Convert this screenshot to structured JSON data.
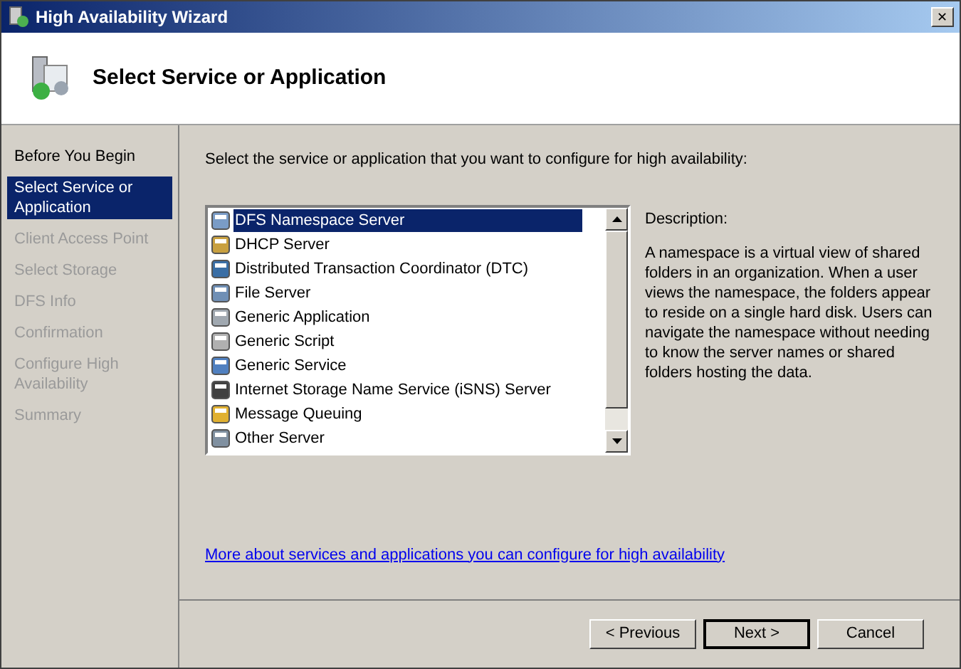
{
  "window": {
    "title": "High Availability Wizard",
    "close": "✕"
  },
  "header": {
    "title": "Select Service or Application"
  },
  "steps": [
    {
      "label": "Before You Begin",
      "selected": false,
      "disabled": false
    },
    {
      "label": "Select Service or Application",
      "selected": true,
      "disabled": false
    },
    {
      "label": "Client Access Point",
      "selected": false,
      "disabled": true
    },
    {
      "label": "Select Storage",
      "selected": false,
      "disabled": true
    },
    {
      "label": "DFS Info",
      "selected": false,
      "disabled": true
    },
    {
      "label": "Confirmation",
      "selected": false,
      "disabled": true
    },
    {
      "label": "Configure High Availability",
      "selected": false,
      "disabled": true
    },
    {
      "label": "Summary",
      "selected": false,
      "disabled": true
    }
  ],
  "instruction": "Select the service or application that you want to configure for high availability:",
  "services": [
    {
      "label": "DFS Namespace Server",
      "selected": true
    },
    {
      "label": "DHCP Server",
      "selected": false
    },
    {
      "label": "Distributed Transaction Coordinator (DTC)",
      "selected": false
    },
    {
      "label": "File Server",
      "selected": false
    },
    {
      "label": "Generic Application",
      "selected": false
    },
    {
      "label": "Generic Script",
      "selected": false
    },
    {
      "label": "Generic Service",
      "selected": false
    },
    {
      "label": "Internet Storage Name Service (iSNS) Server",
      "selected": false
    },
    {
      "label": "Message Queuing",
      "selected": false
    },
    {
      "label": "Other Server",
      "selected": false
    }
  ],
  "description": {
    "label": "Description:",
    "text": "A namespace is a virtual view of shared folders in an organization. When a user views the namespace, the folders appear to reside on a single hard disk. Users can navigate the namespace without needing to know the server names or shared folders hosting the data."
  },
  "link": "More about services and applications you can configure for high availability",
  "buttons": [
    {
      "label": "< Previous",
      "default": false
    },
    {
      "label": "Next >",
      "default": true
    },
    {
      "label": "Cancel",
      "default": false
    }
  ]
}
